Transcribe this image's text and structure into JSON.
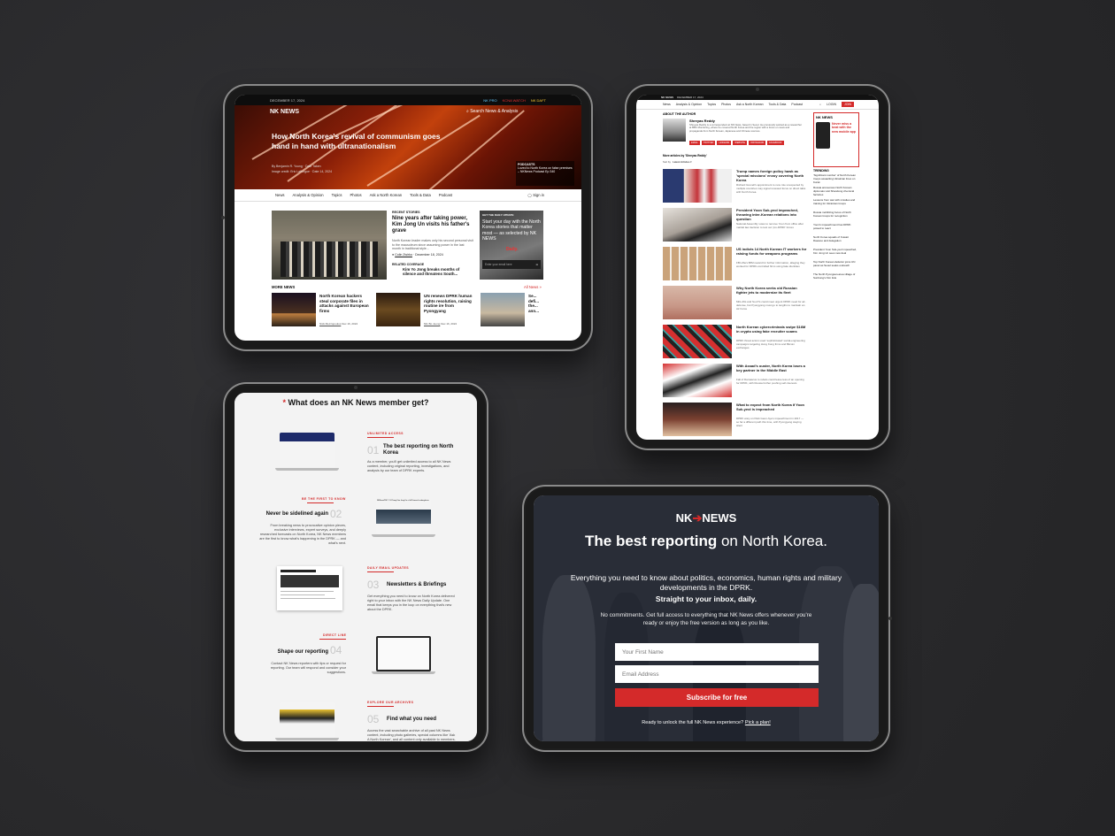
{
  "t1": {
    "date": "DECEMBER 17, 2024",
    "brand_links": [
      "NK PRO",
      "KCNA WATCH",
      "NK DAFT"
    ],
    "logo": "NK NEWS",
    "search_placeholder": "Search News & Analysis",
    "hero_title": "How North Korea's revival of communism goes hand in hand with ultranationalism",
    "hero_byline": "By Benjamin R. Young · Date Taken",
    "hero_credit": "Image credit: Eric Lafforgue · Date 14, 2024",
    "podcast_label": "PODCASTS",
    "podcast_text": "Loved to North Korea on false premises – NKNews Podcast Ep 340",
    "nav": [
      "News",
      "Analysis & Opinion",
      "Topics",
      "Photos",
      "Ask a North Korean",
      "Tools & Data",
      "Podcast"
    ],
    "signin": "Sign in",
    "recent_label": "RECENT STORIES",
    "lead_title": "Nine years after taking power, Kim Jong Un visits his father's grave",
    "lead_summary": "North Korean leader makes only his second personal visit to the mausoleum since assuming power in the last month in traditional style...",
    "lead_author": "Colin Zwirko",
    "lead_date": "December 18, 2024",
    "related_label": "RELATED COVERAGE",
    "related_title": "Kim Yo Jong breaks months of silence and threatens South...",
    "promo_label": "GET THE DAILY UPDATE",
    "promo_text": "Start your day with the North Korea stories that matter most — as selected by NK NEWS",
    "promo_daily": "Daily.",
    "promo_input": "Enter your email here",
    "more_label": "MORE NEWS",
    "all_news": "All News »",
    "more": [
      {
        "title": "North Korean hackers steal corporate files in attacks against European firms",
        "author": "Nick Mezzopoulos",
        "date": "Dec 16, 2024"
      },
      {
        "title": "UN renews DPRK human rights resolution, raising routine ire from Pyongyang",
        "author": "Min Bo Jeong",
        "date": "Dec 16, 2024"
      },
      {
        "title": "Se... defi... the... ann...",
        "author": "",
        "date": ""
      }
    ]
  },
  "t2": {
    "logo": "NK NEWS",
    "date": "DECEMBER 17, 2024",
    "nav": [
      "News",
      "Analysis & Opinion",
      "Topics",
      "Photos",
      "Ask a North Korean",
      "Tools & Data",
      "Podcast"
    ],
    "login": "LOGIN",
    "join": "JOIN",
    "about_label": "ABOUT THE AUTHOR",
    "author_name": "Shreyas Reddy",
    "author_bio": "Shreyas Reddy is a correspondent at NK News, based in Seoul. He previously worked as a researcher at BBC Monitoring, where he covered North Korea and the region with a focus on news and propaganda from North Korean, Japanese and Chinese sources.",
    "author_buttons": [
      "EMAIL",
      "TWITTER",
      "LINKEDIN",
      "WEBSITE",
      "INSTAGRAM",
      "FACEBOOK"
    ],
    "more_articles": "More articles by 'Shreyas Reddy'",
    "sort": "Sort by",
    "sort_value": "Latest Articles",
    "articles": [
      {
        "title": "Trump names foreign policy hawk as 'special missions' envoy covering North Korea",
        "summary": "Richard Grenell's appointment to new role unexpected by multiple countries may signal renewed focus on direct talks with North Korea.",
        "author": "Shreyas Reddy",
        "date": "December 16, 2024"
      },
      {
        "title": "President Yoon Suk-yeol impeached, throwing inter-Korean relations into question",
        "summary": "National Assembly votes to remove Yoon from office after martial law decision to test out 'pro-DPRK' forces",
        "author": "Shreyas Reddy",
        "date": "December 14, 2024"
      },
      {
        "title": "US indicts 14 North Korean IT workers for raising funds for weapons programs",
        "summary": "FBI offers $5M reward for further information, alleging they worked for DPRK-controlled firms using fake identities",
        "author": "Shreyas Reddy",
        "date": "December 13, 2024"
      },
      {
        "title": "Why North Korea seeks old Russian fighter jets to modernize its fleet",
        "summary": "MiG-29s and Su-27s could meet urgent DPRK need for air-defense, but Pyongyang must go to lengths to maintain an Air Force",
        "author": "Joshua Cabrera / Shreyas Reddy",
        "date": "December 12, 2024"
      },
      {
        "title": "North Korean cybercriminals swipe $16M in crypto using fake recruiter scams",
        "summary": "DPRK threat actors used 'sophisticated' social-engineering campaigns targeting Hong Kong firms and Bitcoin exchanges",
        "author": "Shreyas Reddy",
        "date": "December 11, 2024"
      },
      {
        "title": "With Assad's ouster, North Korea loses a key partner in the Middle East",
        "summary": "Fall of Damascus to rebels could leave less of an opening for DPRK, with Russia further pushing self-interests",
        "author": "Shreyas Reddy",
        "date": "December 9, 2024"
      },
      {
        "title": "What to expect from North Korea if Yoon Suk-yeol is impeached",
        "summary": "DPRK wary on Park Geun-hye's impeachment in 2017 — so far a different path this time, with Pyongyang staying silent",
        "author": "Shreyas Reddy",
        "date": "December 6, 2024"
      }
    ],
    "ad_logo": "NK NEWS",
    "ad_text": "Never miss a beat with the new mobile app",
    "trending_label": "TRENDING",
    "trending": [
      "'Significant number' of North Korean troops assaulting Ukrainian lines on Kursk",
      "Russia announces North Korean diplomats visit Shandong chemical factories",
      "Lessons from war with missiles and training for Ukrainian troops",
      "Russia mobilizing focus of North Korean troops for recognition",
      "Yoon's impeachment has DPRK poised to react",
      "North Korea squads of Kuwait Daewoo and delegation",
      "President Yoon Suk-yeol impeached, Kim Jong Un sees new deal",
      "Top North Korean defector joins UN panel as Seoul seeks outreach",
      "The North Pyongsan-area village of Sunhung's Kim lists"
    ]
  },
  "t3": {
    "title": "What does an NK News member get?",
    "features": [
      {
        "kicker": "UNLIMITED ACCESS",
        "num": "01",
        "title": "The best reporting on North Korea",
        "desc": "As a member, you'll get unlimited access to all NK News content, including original reporting, investigations, and analysis by our team of DPRK experts."
      },
      {
        "kicker": "BE THE FIRST TO KNOW",
        "num": "02",
        "title": "Never be sidelined again",
        "desc": "From breaking news to provocative opinion pieces, exclusive interviews, expert surveys, and deeply researched forecasts on North Korea, NK News members are the first to know what's happening in the DPRK — and what's next."
      },
      {
        "kicker": "DAILY EMAIL UPDATES",
        "num": "03",
        "title": "Newsletters & Briefings",
        "desc": "Get everything you need to know on North Korea delivered right to your inbox with the NK News Daily Update. One email that keeps you in the loop on everything that's new about the DPRK."
      },
      {
        "kicker": "DIRECT LINE",
        "num": "04",
        "title": "Shape our reporting",
        "desc": "Contact NK News reporters with tips or request for reporting. Our team will respond and consider your suggestions."
      },
      {
        "kicker": "EXPLORE OUR ARCHIVES",
        "num": "05",
        "title": "Find what you need",
        "desc": "Access the vast searchable archive of all past NK News content, including photo galleries, special columns like 'Ask A North Korean', and all content only available to members."
      }
    ],
    "laptop2_headline": "NKNewsPRO Y S Phony Kim Jong Un a full Korean-Leaderglacier"
  },
  "t4": {
    "logo_left": "NK",
    "logo_right": "NEWS",
    "headline_bold": "The best reporting",
    "headline_rest": "on North Korea.",
    "subhead": "Everything you need to know about politics, economics, human rights and military developments in the DPRK.",
    "subhead_bold": "Straight to your inbox, daily.",
    "note": "No commitments. Get full access to everything that NK News offers whenever you're ready or enjoy the free version as long as you like.",
    "first_name_placeholder": "Your First Name",
    "email_placeholder": "Email Address",
    "subscribe": "Subscribe for free",
    "footer_text": "Ready to unlock the full NK News experience?",
    "footer_link": "Pick a plan!"
  },
  "colors": {
    "brand_red": "#d42a2a",
    "dark": "#1a1a1a",
    "background": "#2b2b2d"
  }
}
